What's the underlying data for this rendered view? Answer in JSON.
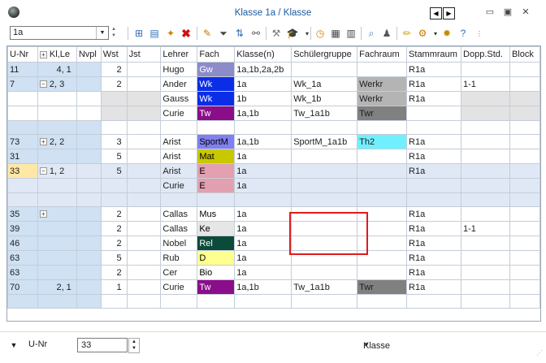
{
  "window": {
    "title": "Klasse 1a / Klasse"
  },
  "toolbar": {
    "class_value": "1a"
  },
  "columns": [
    "U-Nr",
    "Kl,Le",
    "Nvpl",
    "Wst",
    "Jst",
    "Lehrer",
    "Fach",
    "Klasse(n)",
    "Schülergruppe",
    "Fachraum",
    "Stammraum",
    "Dopp.Std.",
    "Block"
  ],
  "rows": [
    {
      "unr": "11",
      "klle": "4, 1",
      "tree": "",
      "wst": "2",
      "lehrer": "Hugo",
      "fach": "Gw",
      "fach_bg": "#8c8cc8",
      "fach_fg": "#ffffff",
      "klassen": "1a,1b,2a,2b",
      "sgruppe": "",
      "fraum": "",
      "fraum_bg": "",
      "sraum": "R1a",
      "dopp": "",
      "type": "main"
    },
    {
      "unr": "7",
      "klle": "2, 3",
      "tree": "−",
      "wst": "2",
      "lehrer": "Ander",
      "fach": "Wk",
      "fach_bg": "#0a2ee8",
      "fach_fg": "#ffffff",
      "klassen": "1a",
      "sgruppe": "Wk_1a",
      "fraum": "Werkr",
      "fraum_bg": "#b4b4b4",
      "sraum": "R1a",
      "dopp": "1-1",
      "type": "main"
    },
    {
      "unr": "",
      "klle": "",
      "tree": "",
      "wst": "",
      "lehrer": "Gauss",
      "fach": "Wk",
      "fach_bg": "#0a2ee8",
      "fach_fg": "#ffffff",
      "klassen": "1b",
      "sgruppe": "Wk_1b",
      "fraum": "Werkr",
      "fraum_bg": "#b4b4b4",
      "sraum": "R1a",
      "dopp": "",
      "type": "child"
    },
    {
      "unr": "",
      "klle": "",
      "tree": "",
      "wst": "",
      "lehrer": "Curie",
      "fach": "Tw",
      "fach_bg": "#8a0e8a",
      "fach_fg": "#ffffff",
      "klassen": "1a,1b",
      "sgruppe": "Tw_1a1b",
      "fraum": "Twr",
      "fraum_bg": "#808080",
      "sraum": "",
      "dopp": "",
      "type": "child"
    },
    {
      "type": "empty"
    },
    {
      "unr": "73",
      "klle": "2, 2",
      "tree": "+",
      "wst": "3",
      "lehrer": "Arist",
      "fach": "SportM",
      "fach_bg": "#8080f0",
      "fach_fg": "#000000",
      "klassen": "1a,1b",
      "sgruppe": "SportM_1a1b",
      "fraum": "Th2",
      "fraum_bg": "#70f0ff",
      "sraum": "R1a",
      "dopp": "",
      "type": "main"
    },
    {
      "unr": "31",
      "klle": "",
      "tree": "",
      "wst": "5",
      "lehrer": "Arist",
      "fach": "Mat",
      "fach_bg": "#c8c800",
      "fach_fg": "#000000",
      "klassen": "1a",
      "sgruppe": "",
      "fraum": "",
      "fraum_bg": "",
      "sraum": "R1a",
      "dopp": "",
      "type": "main"
    },
    {
      "unr": "33",
      "klle": "1, 2",
      "tree": "−",
      "wst": "5",
      "lehrer": "Arist",
      "fach": "E",
      "fach_bg": "#e3a0b0",
      "fach_fg": "#000000",
      "klassen": "1a",
      "sgruppe": "",
      "fraum": "",
      "fraum_bg": "",
      "sraum": "R1a",
      "dopp": "",
      "type": "sel"
    },
    {
      "unr": "",
      "klle": "",
      "tree": "",
      "wst": "",
      "lehrer": "Curie",
      "fach": "E",
      "fach_bg": "#e3a0b0",
      "fach_fg": "#000000",
      "klassen": "1a",
      "sgruppe": "",
      "fraum": "",
      "fraum_bg": "",
      "sraum": "",
      "dopp": "",
      "type": "selchild"
    },
    {
      "type": "selempty"
    },
    {
      "unr": "35",
      "klle": "",
      "tree": "+",
      "wst": "2",
      "lehrer": "Callas",
      "fach": "Mus",
      "fach_bg": "#ffffff",
      "fach_fg": "#000000",
      "klassen": "1a",
      "sgruppe": "",
      "fraum": "",
      "fraum_bg": "",
      "sraum": "R1a",
      "dopp": "",
      "type": "main"
    },
    {
      "unr": "39",
      "klle": "",
      "tree": "",
      "wst": "2",
      "lehrer": "Callas",
      "fach": "Ke",
      "fach_bg": "#e6e6e6",
      "fach_fg": "#000000",
      "klassen": "1a",
      "sgruppe": "",
      "fraum": "",
      "fraum_bg": "",
      "sraum": "R1a",
      "dopp": "1-1",
      "type": "main"
    },
    {
      "unr": "46",
      "klle": "",
      "tree": "",
      "wst": "2",
      "lehrer": "Nobel",
      "fach": "Rel",
      "fach_bg": "#0c4a3a",
      "fach_fg": "#ffffff",
      "klassen": "1a",
      "sgruppe": "",
      "fraum": "",
      "fraum_bg": "",
      "sraum": "R1a",
      "dopp": "",
      "type": "main"
    },
    {
      "unr": "63",
      "klle": "",
      "tree": "",
      "wst": "5",
      "lehrer": "Rub",
      "fach": "D",
      "fach_bg": "#ffff90",
      "fach_fg": "#000000",
      "klassen": "1a",
      "sgruppe": "",
      "fraum": "",
      "fraum_bg": "",
      "sraum": "R1a",
      "dopp": "",
      "type": "main"
    },
    {
      "unr": "63",
      "klle": "",
      "tree": "",
      "wst": "2",
      "lehrer": "Cer",
      "fach": "Bio",
      "fach_bg": "#ffffff",
      "fach_fg": "#000000",
      "klassen": "1a",
      "sgruppe": "",
      "fraum": "",
      "fraum_bg": "",
      "sraum": "R1a",
      "dopp": "",
      "type": "main"
    },
    {
      "unr": "70",
      "klle": "2, 1",
      "tree": "",
      "wst": "1",
      "lehrer": "Curie",
      "fach": "Tw",
      "fach_bg": "#8a0e8a",
      "fach_fg": "#ffffff",
      "klassen": "1a,1b",
      "sgruppe": "Tw_1a1b",
      "fraum": "Twr",
      "fraum_bg": "#808080",
      "sraum": "R1a",
      "dopp": "",
      "type": "main"
    },
    {
      "type": "empty"
    }
  ],
  "statusbar": {
    "field_label": "U-Nr",
    "field_value": "33",
    "view_select": "Klasse"
  }
}
